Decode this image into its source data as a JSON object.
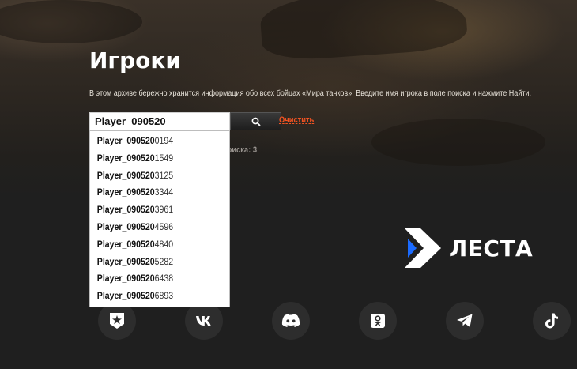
{
  "header": {
    "title": "Игроки",
    "intro": "В этом архиве бережно хранится информация обо всех бойцах «Мира танков». Введите имя игрока в поле поиска и нажмите Найти."
  },
  "search": {
    "value": "Player_090520",
    "button_icon": "search-icon",
    "clear_label": "Очистить",
    "result_count_text": "для поиска: 3"
  },
  "suggestions": [
    {
      "match": "Player_090520",
      "rest": "0194"
    },
    {
      "match": "Player_090520",
      "rest": "1549"
    },
    {
      "match": "Player_090520",
      "rest": "3125"
    },
    {
      "match": "Player_090520",
      "rest": "3344"
    },
    {
      "match": "Player_090520",
      "rest": "3961"
    },
    {
      "match": "Player_090520",
      "rest": "4596"
    },
    {
      "match": "Player_090520",
      "rest": "4840"
    },
    {
      "match": "Player_090520",
      "rest": "5282"
    },
    {
      "match": "Player_090520",
      "rest": "6438"
    },
    {
      "match": "Player_090520",
      "rest": "6893"
    }
  ],
  "footer": {
    "brand_name": "ЛЕСТА",
    "brand_accent": "#1b6bff",
    "socials": [
      {
        "icon": "wot-badge-icon"
      },
      {
        "icon": "vk-icon"
      },
      {
        "icon": "discord-icon"
      },
      {
        "icon": "odnoklassniki-icon"
      },
      {
        "icon": "telegram-icon"
      },
      {
        "icon": "tiktok-icon"
      }
    ]
  }
}
